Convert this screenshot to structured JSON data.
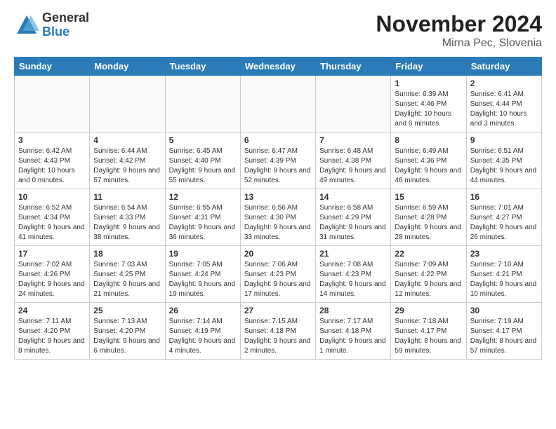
{
  "logo": {
    "general": "General",
    "blue": "Blue"
  },
  "title": "November 2024",
  "subtitle": "Mirna Pec, Slovenia",
  "weekdays": [
    "Sunday",
    "Monday",
    "Tuesday",
    "Wednesday",
    "Thursday",
    "Friday",
    "Saturday"
  ],
  "weeks": [
    [
      {
        "day": "",
        "info": ""
      },
      {
        "day": "",
        "info": ""
      },
      {
        "day": "",
        "info": ""
      },
      {
        "day": "",
        "info": ""
      },
      {
        "day": "",
        "info": ""
      },
      {
        "day": "1",
        "info": "Sunrise: 6:39 AM\nSunset: 4:46 PM\nDaylight: 10 hours and 6 minutes."
      },
      {
        "day": "2",
        "info": "Sunrise: 6:41 AM\nSunset: 4:44 PM\nDaylight: 10 hours and 3 minutes."
      }
    ],
    [
      {
        "day": "3",
        "info": "Sunrise: 6:42 AM\nSunset: 4:43 PM\nDaylight: 10 hours and 0 minutes."
      },
      {
        "day": "4",
        "info": "Sunrise: 6:44 AM\nSunset: 4:42 PM\nDaylight: 9 hours and 57 minutes."
      },
      {
        "day": "5",
        "info": "Sunrise: 6:45 AM\nSunset: 4:40 PM\nDaylight: 9 hours and 55 minutes."
      },
      {
        "day": "6",
        "info": "Sunrise: 6:47 AM\nSunset: 4:39 PM\nDaylight: 9 hours and 52 minutes."
      },
      {
        "day": "7",
        "info": "Sunrise: 6:48 AM\nSunset: 4:38 PM\nDaylight: 9 hours and 49 minutes."
      },
      {
        "day": "8",
        "info": "Sunrise: 6:49 AM\nSunset: 4:36 PM\nDaylight: 9 hours and 46 minutes."
      },
      {
        "day": "9",
        "info": "Sunrise: 6:51 AM\nSunset: 4:35 PM\nDaylight: 9 hours and 44 minutes."
      }
    ],
    [
      {
        "day": "10",
        "info": "Sunrise: 6:52 AM\nSunset: 4:34 PM\nDaylight: 9 hours and 41 minutes."
      },
      {
        "day": "11",
        "info": "Sunrise: 6:54 AM\nSunset: 4:33 PM\nDaylight: 9 hours and 38 minutes."
      },
      {
        "day": "12",
        "info": "Sunrise: 6:55 AM\nSunset: 4:31 PM\nDaylight: 9 hours and 36 minutes."
      },
      {
        "day": "13",
        "info": "Sunrise: 6:56 AM\nSunset: 4:30 PM\nDaylight: 9 hours and 33 minutes."
      },
      {
        "day": "14",
        "info": "Sunrise: 6:58 AM\nSunset: 4:29 PM\nDaylight: 9 hours and 31 minutes."
      },
      {
        "day": "15",
        "info": "Sunrise: 6:59 AM\nSunset: 4:28 PM\nDaylight: 9 hours and 28 minutes."
      },
      {
        "day": "16",
        "info": "Sunrise: 7:01 AM\nSunset: 4:27 PM\nDaylight: 9 hours and 26 minutes."
      }
    ],
    [
      {
        "day": "17",
        "info": "Sunrise: 7:02 AM\nSunset: 4:26 PM\nDaylight: 9 hours and 24 minutes."
      },
      {
        "day": "18",
        "info": "Sunrise: 7:03 AM\nSunset: 4:25 PM\nDaylight: 9 hours and 21 minutes."
      },
      {
        "day": "19",
        "info": "Sunrise: 7:05 AM\nSunset: 4:24 PM\nDaylight: 9 hours and 19 minutes."
      },
      {
        "day": "20",
        "info": "Sunrise: 7:06 AM\nSunset: 4:23 PM\nDaylight: 9 hours and 17 minutes."
      },
      {
        "day": "21",
        "info": "Sunrise: 7:08 AM\nSunset: 4:23 PM\nDaylight: 9 hours and 14 minutes."
      },
      {
        "day": "22",
        "info": "Sunrise: 7:09 AM\nSunset: 4:22 PM\nDaylight: 9 hours and 12 minutes."
      },
      {
        "day": "23",
        "info": "Sunrise: 7:10 AM\nSunset: 4:21 PM\nDaylight: 9 hours and 10 minutes."
      }
    ],
    [
      {
        "day": "24",
        "info": "Sunrise: 7:11 AM\nSunset: 4:20 PM\nDaylight: 9 hours and 8 minutes."
      },
      {
        "day": "25",
        "info": "Sunrise: 7:13 AM\nSunset: 4:20 PM\nDaylight: 9 hours and 6 minutes."
      },
      {
        "day": "26",
        "info": "Sunrise: 7:14 AM\nSunset: 4:19 PM\nDaylight: 9 hours and 4 minutes."
      },
      {
        "day": "27",
        "info": "Sunrise: 7:15 AM\nSunset: 4:18 PM\nDaylight: 9 hours and 2 minutes."
      },
      {
        "day": "28",
        "info": "Sunrise: 7:17 AM\nSunset: 4:18 PM\nDaylight: 9 hours and 1 minute."
      },
      {
        "day": "29",
        "info": "Sunrise: 7:18 AM\nSunset: 4:17 PM\nDaylight: 8 hours and 59 minutes."
      },
      {
        "day": "30",
        "info": "Sunrise: 7:19 AM\nSunset: 4:17 PM\nDaylight: 8 hours and 57 minutes."
      }
    ]
  ]
}
